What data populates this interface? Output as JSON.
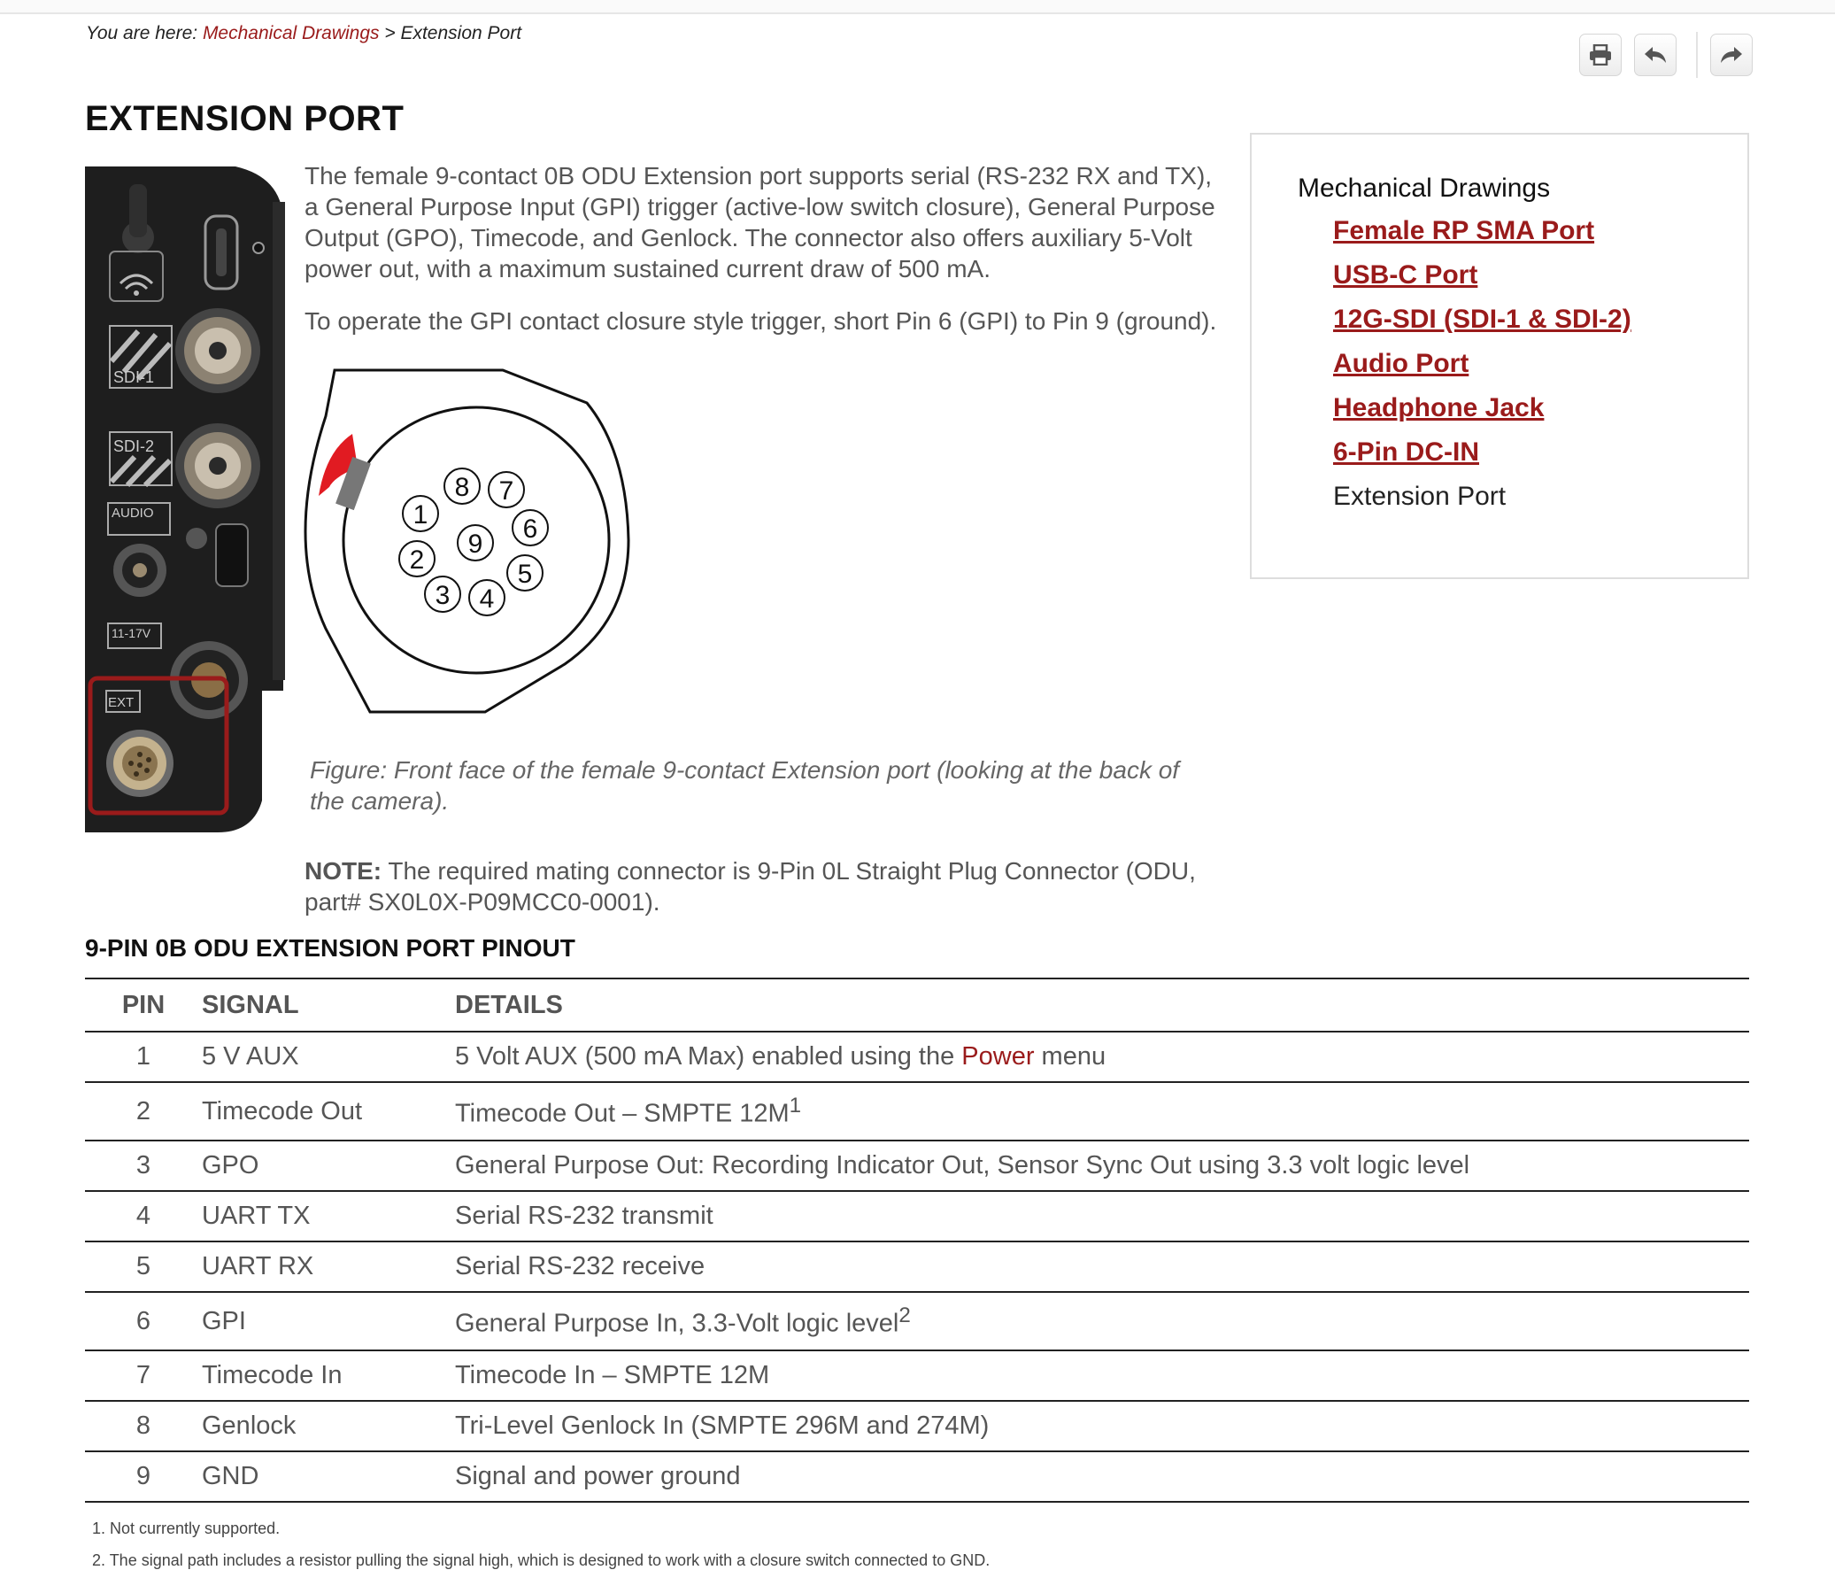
{
  "breadcrumb": {
    "prefix": "You are here: ",
    "parent": "Mechanical Drawings",
    "separator": " > ",
    "current": "Extension Port"
  },
  "toolbar": {
    "print_icon": "print-icon",
    "back_icon": "reply-icon",
    "forward_icon": "forward-icon"
  },
  "page": {
    "title": "EXTENSION PORT",
    "paragraph1": "The female 9-contact 0B ODU Extension port supports serial (RS-232 RX and TX), a General Purpose Input (GPI) trigger (active-low switch closure), General Purpose Output (GPO), Timecode, and Genlock. The connector also offers auxiliary 5-Volt power out, with a maximum sustained current draw of 500 mA.",
    "paragraph2": "To operate the GPI contact closure style trigger, short Pin 6 (GPI) to Pin 9 (ground).",
    "caption": "Figure: Front face of the female 9-contact Extension port (looking at the back of the camera).",
    "note_label": "NOTE:",
    "note_text": " The required mating connector is 9-Pin 0L Straight Plug Connector (ODU, part# SX0L0X-P09MCC0-0001)."
  },
  "camera_labels": {
    "sdi1": "SDI-1",
    "sdi2": "SDI-2",
    "audio": "AUDIO",
    "power": "11-17V",
    "ext": "EXT"
  },
  "pins": [
    "1",
    "2",
    "3",
    "4",
    "5",
    "6",
    "7",
    "8",
    "9"
  ],
  "sidebar": {
    "title": "Mechanical Drawings",
    "items": [
      {
        "label": "Female RP SMA Port"
      },
      {
        "label": "USB-C Port"
      },
      {
        "label": "12G-SDI (SDI-1 & SDI-2)"
      },
      {
        "label": "Audio Port"
      },
      {
        "label": "Headphone Jack"
      },
      {
        "label": "6-Pin DC-IN"
      },
      {
        "label": "Extension Port"
      }
    ]
  },
  "pinout": {
    "heading": "9-PIN 0B ODU EXTENSION PORT PINOUT",
    "columns": [
      "PIN",
      "SIGNAL",
      "DETAILS"
    ],
    "rows": [
      {
        "pin": "1",
        "signal": "5 V AUX",
        "details": "5 Volt AUX (500 mA Max) enabled using the ",
        "link": "Power",
        "after": " menu"
      },
      {
        "pin": "2",
        "signal": "Timecode Out",
        "details": "Timecode Out – SMPTE 12M",
        "sup": "1"
      },
      {
        "pin": "3",
        "signal": "GPO",
        "details": "General Purpose Out: Recording Indicator Out, Sensor Sync Out using 3.3 volt logic level"
      },
      {
        "pin": "4",
        "signal": "UART TX",
        "details": "Serial RS-232 transmit"
      },
      {
        "pin": "5",
        "signal": "UART RX",
        "details": "Serial RS-232 receive"
      },
      {
        "pin": "6",
        "signal": "GPI",
        "details": "General Purpose In, 3.3-Volt logic level",
        "sup": "2"
      },
      {
        "pin": "7",
        "signal": "Timecode In",
        "details": "Timecode In – SMPTE 12M"
      },
      {
        "pin": "8",
        "signal": "Genlock",
        "details": "Tri-Level Genlock In (SMPTE 296M and 274M)"
      },
      {
        "pin": "9",
        "signal": "GND",
        "details": "Signal and power ground"
      }
    ]
  },
  "footnotes": {
    "n1": "1. Not currently supported.",
    "n2": "2. The signal path includes a resistor pulling the signal high, which is designed to work with a closure switch connected to GND."
  },
  "colors": {
    "link": "#9a1b1b",
    "text": "#555555",
    "heading": "#111111"
  }
}
